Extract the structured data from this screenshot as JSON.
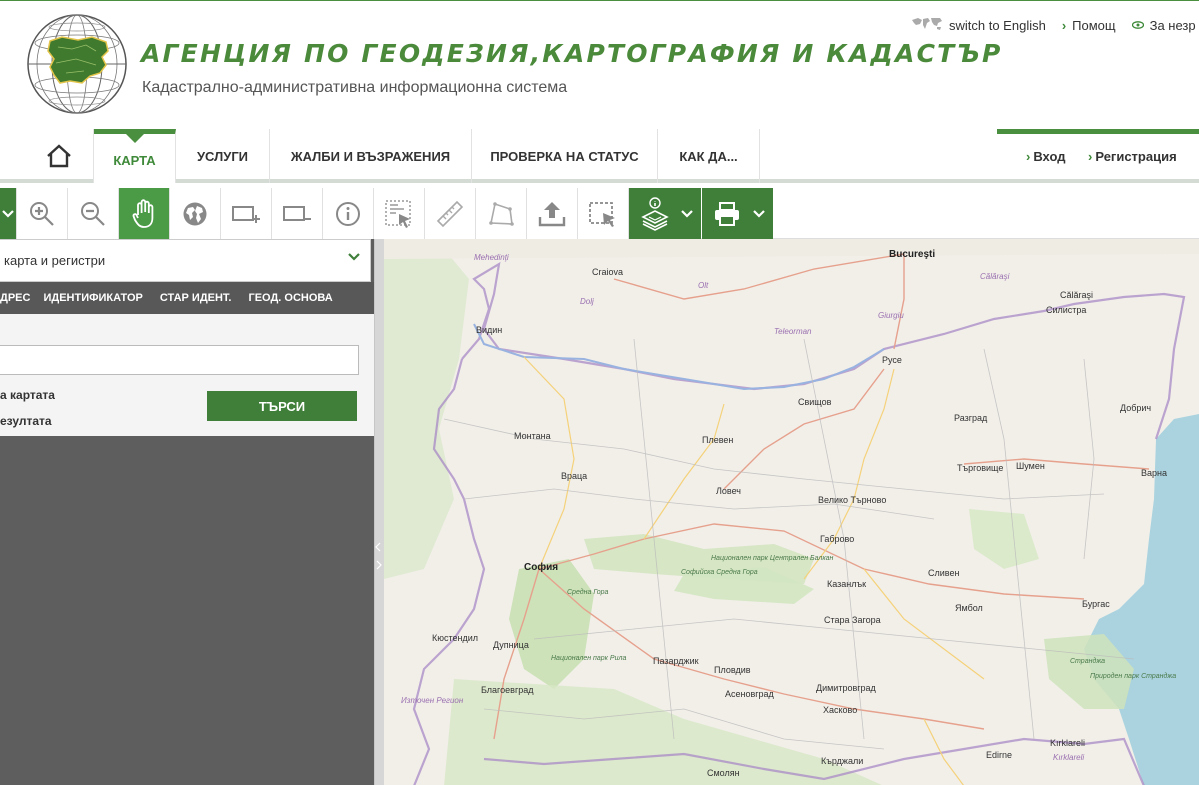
{
  "header": {
    "title": "АГЕНЦИЯ ПО ГЕОДЕЗИЯ,КАРТОГРАФИЯ И КАДАСТЪР",
    "subtitle": "Кадастрално-административна информационна система",
    "links": [
      "switch to English",
      "Помощ",
      "За незр"
    ]
  },
  "nav": {
    "items": [
      "КАРТА",
      "УСЛУГИ",
      "ЖАЛБИ И ВЪЗРАЖЕНИЯ",
      "ПРОВЕРКА НА СТАТУС",
      "КАК ДА..."
    ],
    "login": "Вход",
    "register": "Регистрация"
  },
  "panel": {
    "select_value": "карта и регистри",
    "tabs": [
      "ДРЕС",
      "ИДЕНТИФИКАТОР",
      "СТАР ИДЕНТ.",
      "ГЕОД. ОСНОВА"
    ],
    "search_value": "",
    "option1": "а картата",
    "option2": "езултата",
    "search_button": "ТЪРСИ"
  },
  "map": {
    "labels": [
      {
        "t": "Bucureşti",
        "c": "capital"
      },
      {
        "t": "Craiova",
        "c": "city"
      },
      {
        "t": "Mehedinţi",
        "c": "region"
      },
      {
        "t": "Olt",
        "c": "region"
      },
      {
        "t": "Dolj",
        "c": "region"
      },
      {
        "t": "Teleorman",
        "c": "region"
      },
      {
        "t": "Giurgiu",
        "c": "region"
      },
      {
        "t": "Călăraşi",
        "c": "region"
      },
      {
        "t": "Călăraşi",
        "c": "city"
      },
      {
        "t": "Силистра",
        "c": "city"
      },
      {
        "t": "Видин",
        "c": "city"
      },
      {
        "t": "Русе",
        "c": "city"
      },
      {
        "t": "Свищов",
        "c": "city"
      },
      {
        "t": "Разград",
        "c": "city"
      },
      {
        "t": "Добрич",
        "c": "city"
      },
      {
        "t": "Монтана",
        "c": "city"
      },
      {
        "t": "Плевен",
        "c": "city"
      },
      {
        "t": "Враца",
        "c": "city"
      },
      {
        "t": "Ловеч",
        "c": "city"
      },
      {
        "t": "Велико Търново",
        "c": "city"
      },
      {
        "t": "Търговище",
        "c": "city"
      },
      {
        "t": "Шумен",
        "c": "city"
      },
      {
        "t": "Варна",
        "c": "city"
      },
      {
        "t": "Габрово",
        "c": "city"
      },
      {
        "t": "София",
        "c": "capital"
      },
      {
        "t": "Казанлък",
        "c": "city"
      },
      {
        "t": "Сливен",
        "c": "city"
      },
      {
        "t": "Ямбол",
        "c": "city"
      },
      {
        "t": "Бургас",
        "c": "city"
      },
      {
        "t": "Стара Загора",
        "c": "city"
      },
      {
        "t": "Кюстендил",
        "c": "city"
      },
      {
        "t": "Дупница",
        "c": "city"
      },
      {
        "t": "Пазарджик",
        "c": "city"
      },
      {
        "t": "Пловдив",
        "c": "city"
      },
      {
        "t": "Асеновград",
        "c": "city"
      },
      {
        "t": "Димитровград",
        "c": "city"
      },
      {
        "t": "Хасково",
        "c": "city"
      },
      {
        "t": "Благоевград",
        "c": "city"
      },
      {
        "t": "Източен Регион",
        "c": "region"
      },
      {
        "t": "Смолян",
        "c": "city"
      },
      {
        "t": "Кърджали",
        "c": "city"
      },
      {
        "t": "Kırklareli",
        "c": "city"
      },
      {
        "t": "Kırklareli",
        "c": "region"
      },
      {
        "t": "Edirne",
        "c": "city"
      },
      {
        "t": "Странджа",
        "c": "park"
      },
      {
        "t": "Природен парк Странджа",
        "c": "park"
      },
      {
        "t": "Национален парк Централен Балкан",
        "c": "park"
      },
      {
        "t": "Софийска Средна Гора",
        "c": "park"
      },
      {
        "t": "Средна Гора",
        "c": "park"
      },
      {
        "t": "Национален парк Рила",
        "c": "park"
      }
    ]
  }
}
